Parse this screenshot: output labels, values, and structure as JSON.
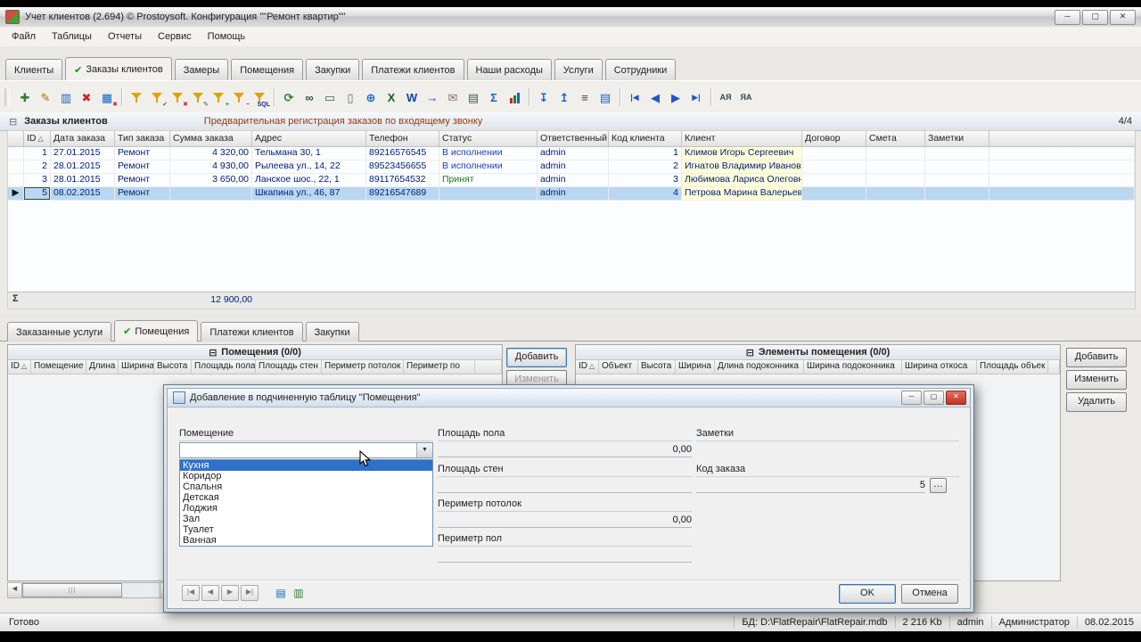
{
  "colors": {
    "accent": "#2f71c9",
    "selection": "#b9d7f1",
    "client_cell": "#ffffd8",
    "data_navy": "#00217a",
    "status_blue": "#1a3fc4",
    "status_green": "#1e7a1e",
    "check_green": "#0a9a0a",
    "subtitle_maroon": "#8a3c10"
  },
  "ui": {
    "check": "✔",
    "sort": "△",
    "collapse": "⊟",
    "sum_symbol": "Σ",
    "row_marker": "▶",
    "combo_arrow": "▼",
    "ellipsis": "…",
    "minimize": "─",
    "maximize": "▢",
    "close": "✕",
    "scroll_left": "◀",
    "scroll_right": "▶",
    "grip": "|||",
    "nav": [
      "|◀",
      "◀",
      "▶",
      "▶|"
    ]
  },
  "window": {
    "title": "Учет клиентов (2.694) © Prostoysoft. Конфигурация \"\"Ремонт квартир\"\""
  },
  "menu": [
    "Файл",
    "Таблицы",
    "Отчеты",
    "Сервис",
    "Помощь"
  ],
  "tabs": [
    {
      "label": "Клиенты",
      "active": false
    },
    {
      "label": "Заказы клиентов",
      "active": true
    },
    {
      "label": "Замеры",
      "active": false
    },
    {
      "label": "Помещения",
      "active": false
    },
    {
      "label": "Закупки",
      "active": false
    },
    {
      "label": "Платежи клиентов",
      "active": false
    },
    {
      "label": "Наши расходы",
      "active": false
    },
    {
      "label": "Услуги",
      "active": false
    },
    {
      "label": "Сотрудники",
      "active": false
    }
  ],
  "toolbar": [
    {
      "name": "add-record-icon",
      "glyph": "✚",
      "color": "#2e7d32"
    },
    {
      "name": "edit-record-icon",
      "glyph": "✎",
      "color": "#b26a00"
    },
    {
      "name": "copy-record-icon",
      "glyph": "▥",
      "color": "#1565c0"
    },
    {
      "name": "delete-record-icon",
      "glyph": "✖",
      "color": "#c62828"
    },
    {
      "name": "delete-filtered-icon",
      "glyph": "▦",
      "color": "#1565c0",
      "badge": "✖",
      "badge_color": "#c62828"
    },
    {
      "sep": true
    },
    {
      "name": "filter-icon",
      "funnel": true
    },
    {
      "name": "filter-apply-icon",
      "funnel": true,
      "badge": "✔",
      "badge_color": "#2e7d32"
    },
    {
      "name": "filter-clear-icon",
      "funnel": true,
      "badge": "✖",
      "badge_color": "#c62828"
    },
    {
      "name": "filter-edit-icon",
      "funnel": true,
      "badge": "✎",
      "badge_color": "#5d4037"
    },
    {
      "name": "filter-by-selection-icon",
      "funnel": true,
      "badge": "+",
      "badge_color": "#2e7d32"
    },
    {
      "name": "filter-exclude-icon",
      "funnel": true,
      "badge": "−",
      "badge_color": "#c62828"
    },
    {
      "name": "filter-sql-icon",
      "funnel": true,
      "badge": "SQL",
      "badge_color": "#1a237e"
    },
    {
      "sep": true
    },
    {
      "name": "refresh-icon",
      "glyph": "⟳",
      "color": "#2e7d32"
    },
    {
      "name": "find-icon",
      "glyph": "∞",
      "color": "#37474f"
    },
    {
      "name": "print-icon",
      "glyph": "▭",
      "color": "#455a64"
    },
    {
      "name": "print-preview-icon",
      "glyph": "▯",
      "color": "#546e7a"
    },
    {
      "name": "export-html-icon",
      "glyph": "⊕",
      "color": "#1565c0"
    },
    {
      "name": "export-excel-icon",
      "glyph": "X",
      "color": "#1b5e20"
    },
    {
      "name": "export-word-icon",
      "glyph": "W",
      "color": "#0d47a1"
    },
    {
      "name": "export-file-icon",
      "glyph": "→",
      "color": "#6a1b9a"
    },
    {
      "name": "send-mail-icon",
      "glyph": "✉",
      "color": "#8d6e63"
    },
    {
      "name": "copy-cell-icon",
      "glyph": "▤",
      "color": "#455a64"
    },
    {
      "name": "totals-icon",
      "glyph": "Σ",
      "color": "#1565c0"
    },
    {
      "name": "chart-icon",
      "bars": true
    },
    {
      "sep": true
    },
    {
      "name": "subtable-down-icon",
      "glyph": "↧",
      "color": "#1565c0"
    },
    {
      "name": "subtable-up-icon",
      "glyph": "↥",
      "color": "#1565c0"
    },
    {
      "name": "tree-view-icon",
      "glyph": "≡",
      "color": "#5d4037"
    },
    {
      "name": "card-view-icon",
      "glyph": "▤",
      "color": "#1565c0"
    },
    {
      "sep": true
    },
    {
      "name": "nav-first-icon",
      "glyph": "|◀",
      "color": "#2255cc"
    },
    {
      "name": "nav-prev-icon",
      "glyph": "◀",
      "color": "#2255cc"
    },
    {
      "name": "nav-next-icon",
      "glyph": "▶",
      "color": "#2255cc"
    },
    {
      "name": "nav-last-icon",
      "glyph": "▶|",
      "color": "#2255cc"
    },
    {
      "sep": true
    },
    {
      "name": "sort-asc-icon",
      "glyph": "АЯ",
      "color": "#37474f"
    },
    {
      "name": "sort-desc-icon",
      "glyph": "ЯА",
      "color": "#37474f"
    }
  ],
  "main_table": {
    "title": "Заказы клиентов",
    "subtitle": "Предварительная регистрация заказов по входящему звонку",
    "counter": "4/4",
    "columns": [
      "ID",
      "Дата заказа",
      "Тип заказа",
      "Сумма заказа",
      "Адрес",
      "Телефон",
      "Статус",
      "Ответственный",
      "Код клиента",
      "Клиент",
      "Договор",
      "Смета",
      "Заметки"
    ],
    "rows": [
      {
        "id": "1",
        "date": "27.01.2015",
        "type": "Ремонт",
        "sum": "4 320,00",
        "address": "Тельмана 30, 1",
        "phone": "89216576545",
        "status": "В исполнении",
        "resp": "admin",
        "client_code": "1",
        "client": "Климов Игорь Сергеевич",
        "contract": "",
        "estimate": "",
        "notes": "",
        "selected": false
      },
      {
        "id": "2",
        "date": "28.01.2015",
        "type": "Ремонт",
        "sum": "4 930,00",
        "address": "Рылеева ул., 14, 22",
        "phone": "89523456655",
        "status": "В исполнении",
        "resp": "admin",
        "client_code": "2",
        "client": "Игнатов Владимир Иванович",
        "contract": "",
        "estimate": "",
        "notes": "",
        "selected": false
      },
      {
        "id": "3",
        "date": "28.01.2015",
        "type": "Ремонт",
        "sum": "3 650,00",
        "address": "Ланское шос., 22, 1",
        "phone": "89117654532",
        "status": "Принят",
        "resp": "admin",
        "client_code": "3",
        "client": "Любимова Лариса Олеговна",
        "contract": "",
        "estimate": "",
        "notes": "",
        "selected": false
      },
      {
        "id": "5",
        "date": "08.02.2015",
        "type": "Ремонт",
        "sum": "",
        "address": "Шкапина ул., 46, 87",
        "phone": "89216547689",
        "status": "",
        "resp": "admin",
        "client_code": "4",
        "client": "Петрова Марина Валерьевна",
        "contract": "",
        "estimate": "",
        "notes": "",
        "selected": true
      }
    ],
    "sum_value": "12 900,00"
  },
  "sub_tabs": [
    {
      "label": "Заказанные услуги",
      "active": false
    },
    {
      "label": "Помещения",
      "active": true
    },
    {
      "label": "Платежи клиентов",
      "active": false
    },
    {
      "label": "Закупки",
      "active": false
    }
  ],
  "rooms_panel": {
    "title": "Помещения (0/0)",
    "columns": [
      "ID",
      "Помещение",
      "Длина",
      "Ширина",
      "Высота",
      "Площадь пола",
      "Площадь стен",
      "Периметр потолок",
      "Периметр по"
    ],
    "buttons": [
      "Добавить",
      "Изменить"
    ]
  },
  "elements_panel": {
    "title": "Элементы помещения (0/0)",
    "columns": [
      "ID",
      "Объект",
      "Высота",
      "Ширина",
      "Длина подоконника",
      "Ширина подоконника",
      "Ширина откоса",
      "Площадь объек"
    ],
    "buttons": [
      "Добавить",
      "Изменить",
      "Удалить"
    ]
  },
  "dialog": {
    "title": "Добавление в подчиненную таблицу \"Помещения\"",
    "combo": {
      "label": "Помещение",
      "value": "",
      "items": [
        "Кухня",
        "Коридор",
        "Спальня",
        "Детская",
        "Лоджия",
        "Зал",
        "Туалет",
        "Ванная"
      ],
      "selected_index": 0
    },
    "fields": [
      {
        "label": "Площадь пола",
        "value": "0,00"
      },
      {
        "label": "Площадь стен",
        "value": ""
      },
      {
        "label": "Периметр потолок",
        "value": "0,00"
      },
      {
        "label": "Периметр пол",
        "value": ""
      }
    ],
    "notes_label": "Заметки",
    "order_code": {
      "label": "Код заказа",
      "value": "5"
    },
    "ok": "OK",
    "cancel": "Отмена"
  },
  "status_bar": {
    "ready": "Готово",
    "sections": [
      "БД: D:\\FlatRepair\\FlatRepair.mdb",
      "2 216 Kb",
      "admin",
      "Администратор",
      "08.02.2015"
    ]
  }
}
